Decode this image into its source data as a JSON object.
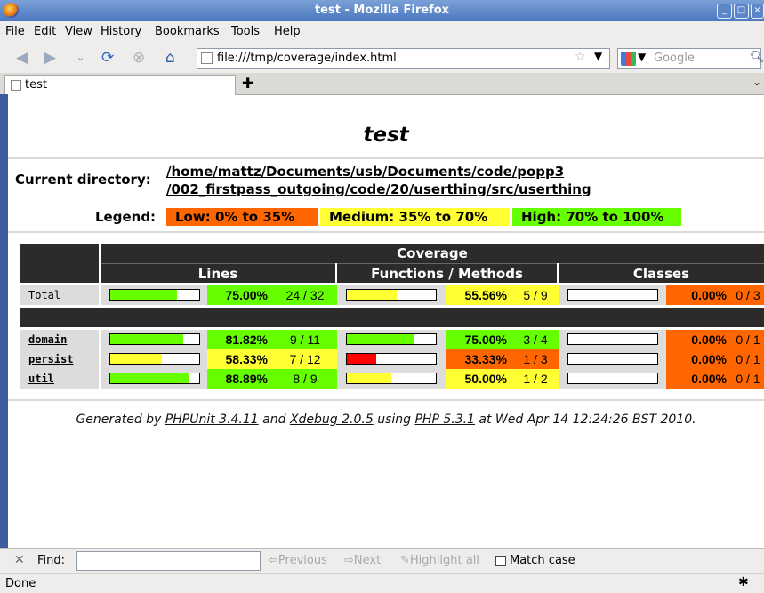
{
  "window": {
    "title": "test - Mozilla Firefox"
  },
  "menu": [
    "File",
    "Edit",
    "View",
    "History",
    "Bookmarks",
    "Tools",
    "Help"
  ],
  "nav": {
    "url": "file:///tmp/coverage/index.html",
    "search_placeholder": "Google"
  },
  "tab": {
    "label": "test"
  },
  "page": {
    "title": "test",
    "current_directory_label": "Current directory:",
    "current_directory_line1": "/home/mattz/Documents/usb/Documents/code/popp3",
    "current_directory_line2": "/002_firstpass_outgoing/code/20/userthing/src/userthing",
    "legend_label": "Legend:",
    "legend": [
      {
        "label": "Low: 0% to 35%",
        "color": "#ff6600"
      },
      {
        "label": "Medium: 35% to 70%",
        "color": "#ffff33"
      },
      {
        "label": "High: 70% to 100%",
        "color": "#66ff00"
      }
    ],
    "table": {
      "coverage_header": "Coverage",
      "columns": [
        "Lines",
        "Functions / Methods",
        "Classes"
      ],
      "rows": [
        {
          "name": "Total",
          "link": false,
          "lines": {
            "fill": 0.75,
            "pct": "75.00%",
            "count": "24 / 32"
          },
          "functions": {
            "fill": 0.5556,
            "pct": "55.56%",
            "count": "5 / 9"
          },
          "classes": {
            "fill": 0.0,
            "pct": "0.00%",
            "count": "0 / 3"
          }
        },
        {
          "name": "domain",
          "link": true,
          "lines": {
            "fill": 0.8182,
            "pct": "81.82%",
            "count": "9 / 11"
          },
          "functions": {
            "fill": 0.75,
            "pct": "75.00%",
            "count": "3 / 4"
          },
          "classes": {
            "fill": 0.0,
            "pct": "0.00%",
            "count": "0 / 1"
          }
        },
        {
          "name": "persist",
          "link": true,
          "lines": {
            "fill": 0.5833,
            "pct": "58.33%",
            "count": "7 / 12"
          },
          "functions": {
            "fill": 0.3333,
            "pct": "33.33%",
            "count": "1 / 3"
          },
          "classes": {
            "fill": 0.0,
            "pct": "0.00%",
            "count": "0 / 1"
          }
        },
        {
          "name": "util",
          "link": true,
          "lines": {
            "fill": 0.8889,
            "pct": "88.89%",
            "count": "8 / 9"
          },
          "functions": {
            "fill": 0.5,
            "pct": "50.00%",
            "count": "1 / 2"
          },
          "classes": {
            "fill": 0.0,
            "pct": "0.00%",
            "count": "0 / 1"
          }
        }
      ],
      "colors": {
        "high_bg": "#66ff00",
        "med_bg": "#ffff33",
        "low_bg": "#ff6600",
        "high_fill": "#66ff00",
        "med_fill": "#ffff33",
        "low_fill": "#ff0000"
      }
    },
    "footer": {
      "p1": "Generated by ",
      "phpunit": "PHPUnit 3.4.11",
      "p2": " and ",
      "xdebug": "Xdebug 2.0.5",
      "p3": " using ",
      "php": "PHP 5.3.1",
      "p4": " at Wed Apr 14 12:24:26 BST 2010."
    }
  },
  "findbar": {
    "label": "Find:",
    "previous": "Previous",
    "next": "Next",
    "highlight": "Highlight all",
    "match_case": "Match case"
  },
  "status": {
    "text": "Done"
  }
}
